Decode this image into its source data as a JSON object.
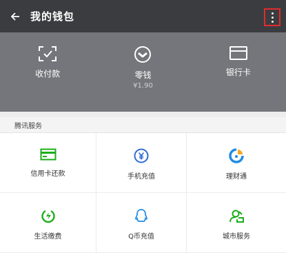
{
  "header": {
    "back_icon": "arrow-left-icon",
    "title": "我的钱包",
    "more_icon": "more-vertical-icon"
  },
  "wallet": {
    "items": [
      {
        "label": "收付款",
        "icon": "scan-check-icon"
      },
      {
        "label": "零钱",
        "sub": "¥1.90",
        "icon": "coin-icon"
      },
      {
        "label": "银行卡",
        "icon": "card-icon"
      }
    ]
  },
  "services": {
    "heading": "腾讯服务",
    "accent": "#1aad19",
    "items": [
      {
        "label": "信用卡还款",
        "icon": "credit-card-icon",
        "color": "#1aad19"
      },
      {
        "label": "手机充值",
        "icon": "yuan-coin-icon",
        "color": "#2b6cd3"
      },
      {
        "label": "理财通",
        "icon": "licaitong-icon",
        "color": "#1f8ce6"
      },
      {
        "label": "生活缴费",
        "icon": "life-payment-icon",
        "color": "#1aad19"
      },
      {
        "label": "Q币充值",
        "icon": "qq-penguin-icon",
        "color": "#1f8ce6"
      },
      {
        "label": "城市服务",
        "icon": "city-service-icon",
        "color": "#1aad19"
      }
    ]
  }
}
